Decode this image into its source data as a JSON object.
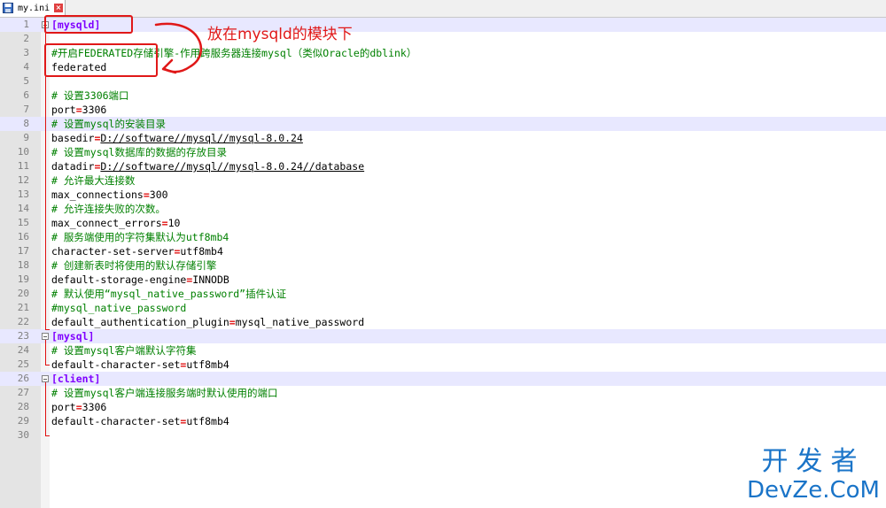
{
  "tab": {
    "filename": "my.ini",
    "close": "×"
  },
  "annotation": {
    "label": "放在mysqld的模块下"
  },
  "watermark": {
    "line1": "开发者",
    "line2": "DevZe.CoM"
  },
  "lines": [
    {
      "n": "1",
      "parts": [
        {
          "t": "[mysqld]",
          "c": "sec"
        }
      ]
    },
    {
      "n": "2",
      "parts": []
    },
    {
      "n": "3",
      "parts": [
        {
          "t": "#开启FEDERATED存储引擎-作用跨服务器连接mysql（类似Oracle的dblink）",
          "c": "cmt"
        }
      ]
    },
    {
      "n": "4",
      "parts": [
        {
          "t": "federated",
          "c": "kw"
        }
      ]
    },
    {
      "n": "5",
      "parts": []
    },
    {
      "n": "6",
      "parts": [
        {
          "t": "# 设置3306端口",
          "c": "cmt"
        }
      ]
    },
    {
      "n": "7",
      "parts": [
        {
          "t": "port",
          "c": "kw"
        },
        {
          "t": "=",
          "c": "eq"
        },
        {
          "t": "3306",
          "c": "val"
        }
      ]
    },
    {
      "n": "8",
      "parts": [
        {
          "t": "# 设置mysql的安装目录",
          "c": "cmt"
        }
      ]
    },
    {
      "n": "9",
      "parts": [
        {
          "t": "basedir",
          "c": "kw"
        },
        {
          "t": "=",
          "c": "eq"
        },
        {
          "t": "D://software//mysql//mysql-8.0.24",
          "c": "val ul"
        }
      ]
    },
    {
      "n": "10",
      "parts": [
        {
          "t": "# 设置mysql数据库的数据的存放目录",
          "c": "cmt"
        }
      ]
    },
    {
      "n": "11",
      "parts": [
        {
          "t": "datadir",
          "c": "kw"
        },
        {
          "t": "=",
          "c": "eq"
        },
        {
          "t": "D://software//mysql//mysql-8.0.24//database",
          "c": "val ul"
        }
      ]
    },
    {
      "n": "12",
      "parts": [
        {
          "t": "# 允许最大连接数",
          "c": "cmt"
        }
      ]
    },
    {
      "n": "13",
      "parts": [
        {
          "t": "max_connections",
          "c": "kw"
        },
        {
          "t": "=",
          "c": "eq"
        },
        {
          "t": "300",
          "c": "val"
        }
      ]
    },
    {
      "n": "14",
      "parts": [
        {
          "t": "# 允许连接失败的次数。",
          "c": "cmt"
        }
      ]
    },
    {
      "n": "15",
      "parts": [
        {
          "t": "max_connect_errors",
          "c": "kw"
        },
        {
          "t": "=",
          "c": "eq"
        },
        {
          "t": "10",
          "c": "val"
        }
      ]
    },
    {
      "n": "16",
      "parts": [
        {
          "t": "# 服务端使用的字符集默认为utf8mb4",
          "c": "cmt"
        }
      ]
    },
    {
      "n": "17",
      "parts": [
        {
          "t": "character-set-server",
          "c": "kw"
        },
        {
          "t": "=",
          "c": "eq"
        },
        {
          "t": "utf8mb4",
          "c": "val"
        }
      ]
    },
    {
      "n": "18",
      "parts": [
        {
          "t": "# 创建新表时将使用的默认存储引擎",
          "c": "cmt"
        }
      ]
    },
    {
      "n": "19",
      "parts": [
        {
          "t": "default-storage-engine",
          "c": "kw"
        },
        {
          "t": "=",
          "c": "eq"
        },
        {
          "t": "INNODB",
          "c": "val"
        }
      ]
    },
    {
      "n": "20",
      "parts": [
        {
          "t": "# 默认使用“mysql_native_password”插件认证",
          "c": "cmt"
        }
      ]
    },
    {
      "n": "21",
      "parts": [
        {
          "t": "#mysql_native_password",
          "c": "cmt"
        }
      ]
    },
    {
      "n": "22",
      "parts": [
        {
          "t": "default_authentication_plugin",
          "c": "kw"
        },
        {
          "t": "=",
          "c": "eq"
        },
        {
          "t": "mysql_native_password",
          "c": "val"
        }
      ]
    },
    {
      "n": "23",
      "parts": [
        {
          "t": "[mysql]",
          "c": "sec"
        }
      ]
    },
    {
      "n": "24",
      "parts": [
        {
          "t": "# 设置mysql客户端默认字符集",
          "c": "cmt"
        }
      ]
    },
    {
      "n": "25",
      "parts": [
        {
          "t": "default-character-set",
          "c": "kw"
        },
        {
          "t": "=",
          "c": "eq"
        },
        {
          "t": "utf8mb4",
          "c": "val"
        }
      ]
    },
    {
      "n": "26",
      "parts": [
        {
          "t": "[client]",
          "c": "sec"
        }
      ]
    },
    {
      "n": "27",
      "parts": [
        {
          "t": "# 设置mysql客户端连接服务端时默认使用的端口",
          "c": "cmt"
        }
      ]
    },
    {
      "n": "28",
      "parts": [
        {
          "t": "port",
          "c": "kw"
        },
        {
          "t": "=",
          "c": "eq"
        },
        {
          "t": "3306",
          "c": "val"
        }
      ]
    },
    {
      "n": "29",
      "parts": [
        {
          "t": "default-character-set",
          "c": "kw"
        },
        {
          "t": "=",
          "c": "eq"
        },
        {
          "t": "utf8mb4",
          "c": "val"
        }
      ]
    },
    {
      "n": "30",
      "parts": []
    }
  ]
}
